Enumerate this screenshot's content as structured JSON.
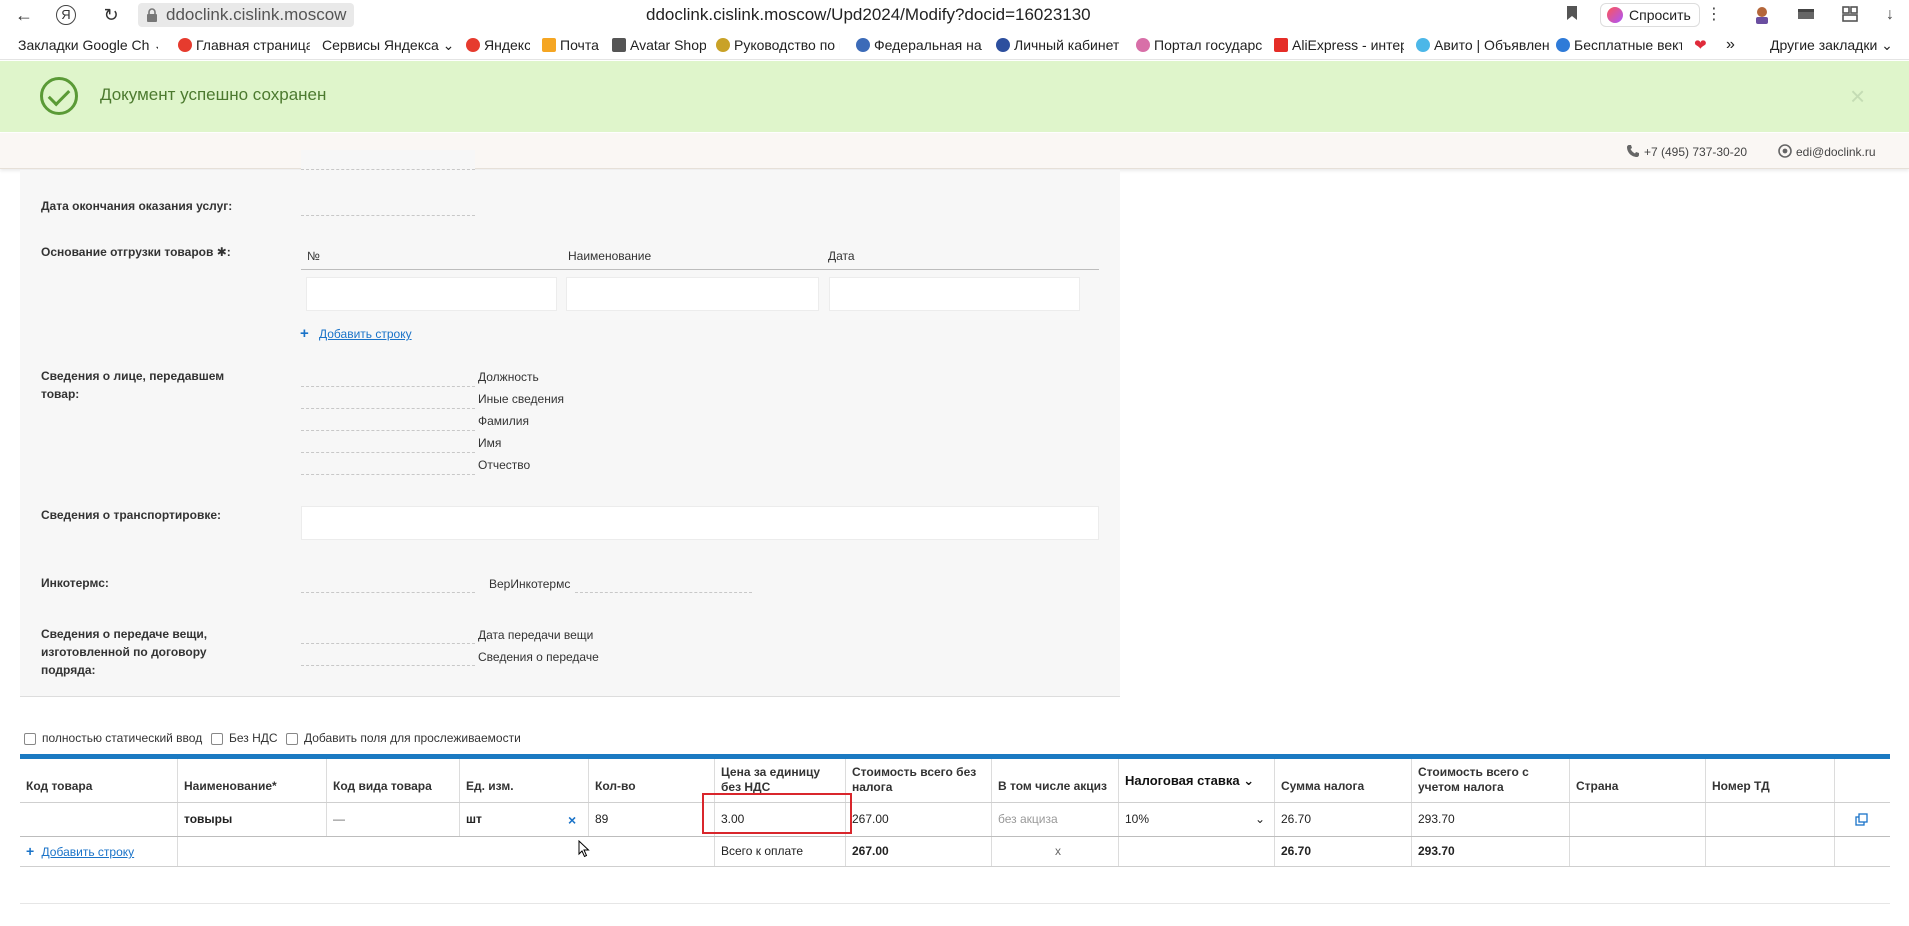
{
  "browser": {
    "url_host": "ddoclink.cislink.moscow",
    "url_full": "ddoclink.cislink.moscow/Upd2024/Modify?docid=16023130",
    "ask_label": "Спросить"
  },
  "bookmarks": {
    "items": [
      "Закладки Google Ch",
      "Главная страница",
      "Сервисы Яндекса",
      "Яндекс",
      "Почта",
      "Avatar Shop",
      "Руководство по п",
      "Федеральная нал",
      "Личный кабинет н",
      "Портал государс",
      "AliExpress - интер",
      "Авито | Объявлен",
      "Бесплатные векто"
    ],
    "more": "»",
    "other": "Другие закладки"
  },
  "banner": {
    "text": "Документ успешно сохранен",
    "close": "×"
  },
  "contacts": {
    "phone": "+7 (495) 737-30-20",
    "email": "edi@doclink.ru"
  },
  "form": {
    "service_end_label": "Дата окончания оказания услуг:",
    "shipment_basis_label": "Основание отгрузки товаров ✱:",
    "basis_columns": [
      "№",
      "Наименование",
      "Дата"
    ],
    "add_row": "Добавить строку",
    "transferrer_label": "Сведения о лице, передавшем товар:",
    "transferrer_fields": [
      "Должность",
      "Иные сведения",
      "Фамилия",
      "Имя",
      "Отчество"
    ],
    "transport_label": "Сведения о транспортировке:",
    "incoterms_label": "Инкотермс:",
    "ver_incoterms": "ВерИнкотермс",
    "thing_transfer_label": "Сведения о передаче вещи, изготовленной по договору подряда:",
    "thing_fields": [
      "Дата передачи вещи",
      "Сведения о передаче"
    ]
  },
  "options": {
    "static_input": "полностью статический ввод",
    "no_vat": "Без НДС",
    "tracking_fields": "Добавить поля для прослеживаемости"
  },
  "table": {
    "headers": {
      "code": "Код товара",
      "name": "Наименование*",
      "kind": "Код вида товара",
      "unit": "Ед. изм.",
      "qty": "Кол-во",
      "price": "Цена за единицу без НДС",
      "cost": "Стоимость всего без налога",
      "excise": "В том числе акциз",
      "rate": "Налоговая ставка",
      "tax": "Сумма налога",
      "total": "Стоимость всего с учетом налога",
      "country": "Страна",
      "td": "Номер ТД"
    },
    "row": {
      "code": "",
      "name": "товыры",
      "kind": "—",
      "unit": "шт",
      "qty": "89",
      "price": "3.00",
      "cost": "267.00",
      "excise_placeholder": "без акциза",
      "rate": "10%",
      "tax": "26.70",
      "total": "293.70"
    },
    "footer": {
      "add_row": "Добавить строку",
      "total_label": "Всего к оплате",
      "cost": "267.00",
      "excise": "x",
      "tax": "26.70",
      "total": "293.70"
    }
  },
  "colors": {
    "accent": "#1b7ac2",
    "success_bg": "#dff5cb",
    "highlight": "#d9262c"
  }
}
